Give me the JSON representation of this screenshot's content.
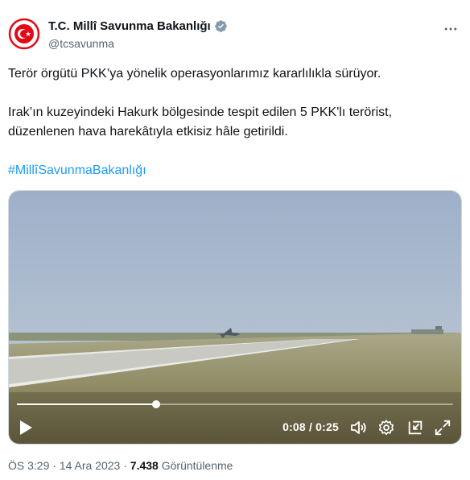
{
  "account": {
    "name": "T.C. Millî Savunma Bakanlığı",
    "handle": "@tcsavunma",
    "verified_color": "#829aab",
    "avatar_color": "#e30a17"
  },
  "tweet": {
    "line1": "Terör örgütü PKK’ya yönelik operasyonlarımız kararlılıkla sürüyor.",
    "line2": "Irak’ın kuzeyindeki Hakurk bölgesinde tespit edilen 5 PKK'lı terörist,",
    "line3": "düzenlenen hava harekâtıyla etkisiz hâle getirildi.",
    "hashtag": "#MillîSavunmaBakanlığı",
    "hashtag_color": "#1d9bf0"
  },
  "video": {
    "time": "0:08 / 0:25",
    "progress": 0.32
  },
  "meta": {
    "time": "ÖS 3:29",
    "sep1": " · ",
    "date": "14 Ara 2023",
    "sep2": " · ",
    "views": "7.438",
    "views_label": " Görüntülenme"
  }
}
